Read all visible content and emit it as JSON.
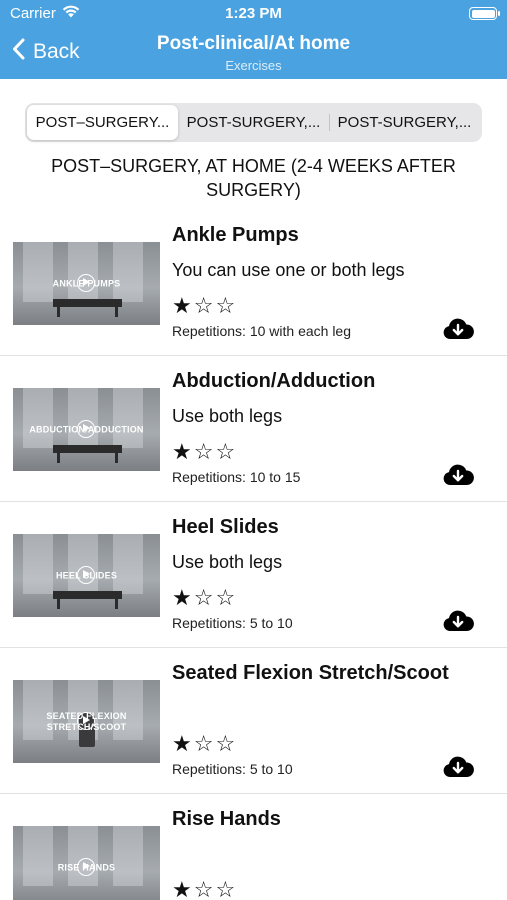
{
  "status": {
    "carrier": "Carrier",
    "time": "1:23 PM"
  },
  "nav": {
    "back_label": "Back",
    "title": "Post-clinical/At home",
    "subtitle": "Exercises"
  },
  "segments": [
    {
      "label": "POST–SURGERY...",
      "selected": true
    },
    {
      "label": "POST-SURGERY,...",
      "selected": false
    },
    {
      "label": "POST-SURGERY,...",
      "selected": false
    }
  ],
  "section_title": "POST–SURGERY, AT HOME (2-4 WEEKS AFTER SURGERY)",
  "exercises": [
    {
      "title": "Ankle Pumps",
      "thumbnail_text": "ANKLE PUMPS",
      "description": "You can use one or both legs",
      "stars": "★☆☆",
      "rating": 1,
      "repetitions": "Repetitions: 10 with each leg"
    },
    {
      "title": "Abduction/Adduction",
      "thumbnail_text": "ABDUCTION/ADDUCTION",
      "description": "Use both legs",
      "stars": "★☆☆",
      "rating": 1,
      "repetitions": "Repetitions: 10 to 15"
    },
    {
      "title": "Heel Slides",
      "thumbnail_text": "HEEL SLIDES",
      "description": "Use both legs",
      "stars": "★☆☆",
      "rating": 1,
      "repetitions": "Repetitions: 5 to 10"
    },
    {
      "title": "Seated Flexion Stretch/Scoot",
      "thumbnail_text": "SEATED FLEXION STRETCH/SCOOT",
      "description": "",
      "stars": "★☆☆",
      "rating": 1,
      "repetitions": "Repetitions: 5 to 10"
    },
    {
      "title": "Rise Hands",
      "thumbnail_text": "RISE HANDS",
      "description": "",
      "stars": "★☆☆",
      "rating": 1,
      "repetitions": ""
    }
  ],
  "colors": {
    "nav_background": "#4aa3e0",
    "nav_text": "#ffffff"
  },
  "icons": [
    "wifi-icon",
    "battery-icon",
    "chevron-left-icon",
    "play-icon",
    "cloud-download-icon",
    "star-icon"
  ]
}
